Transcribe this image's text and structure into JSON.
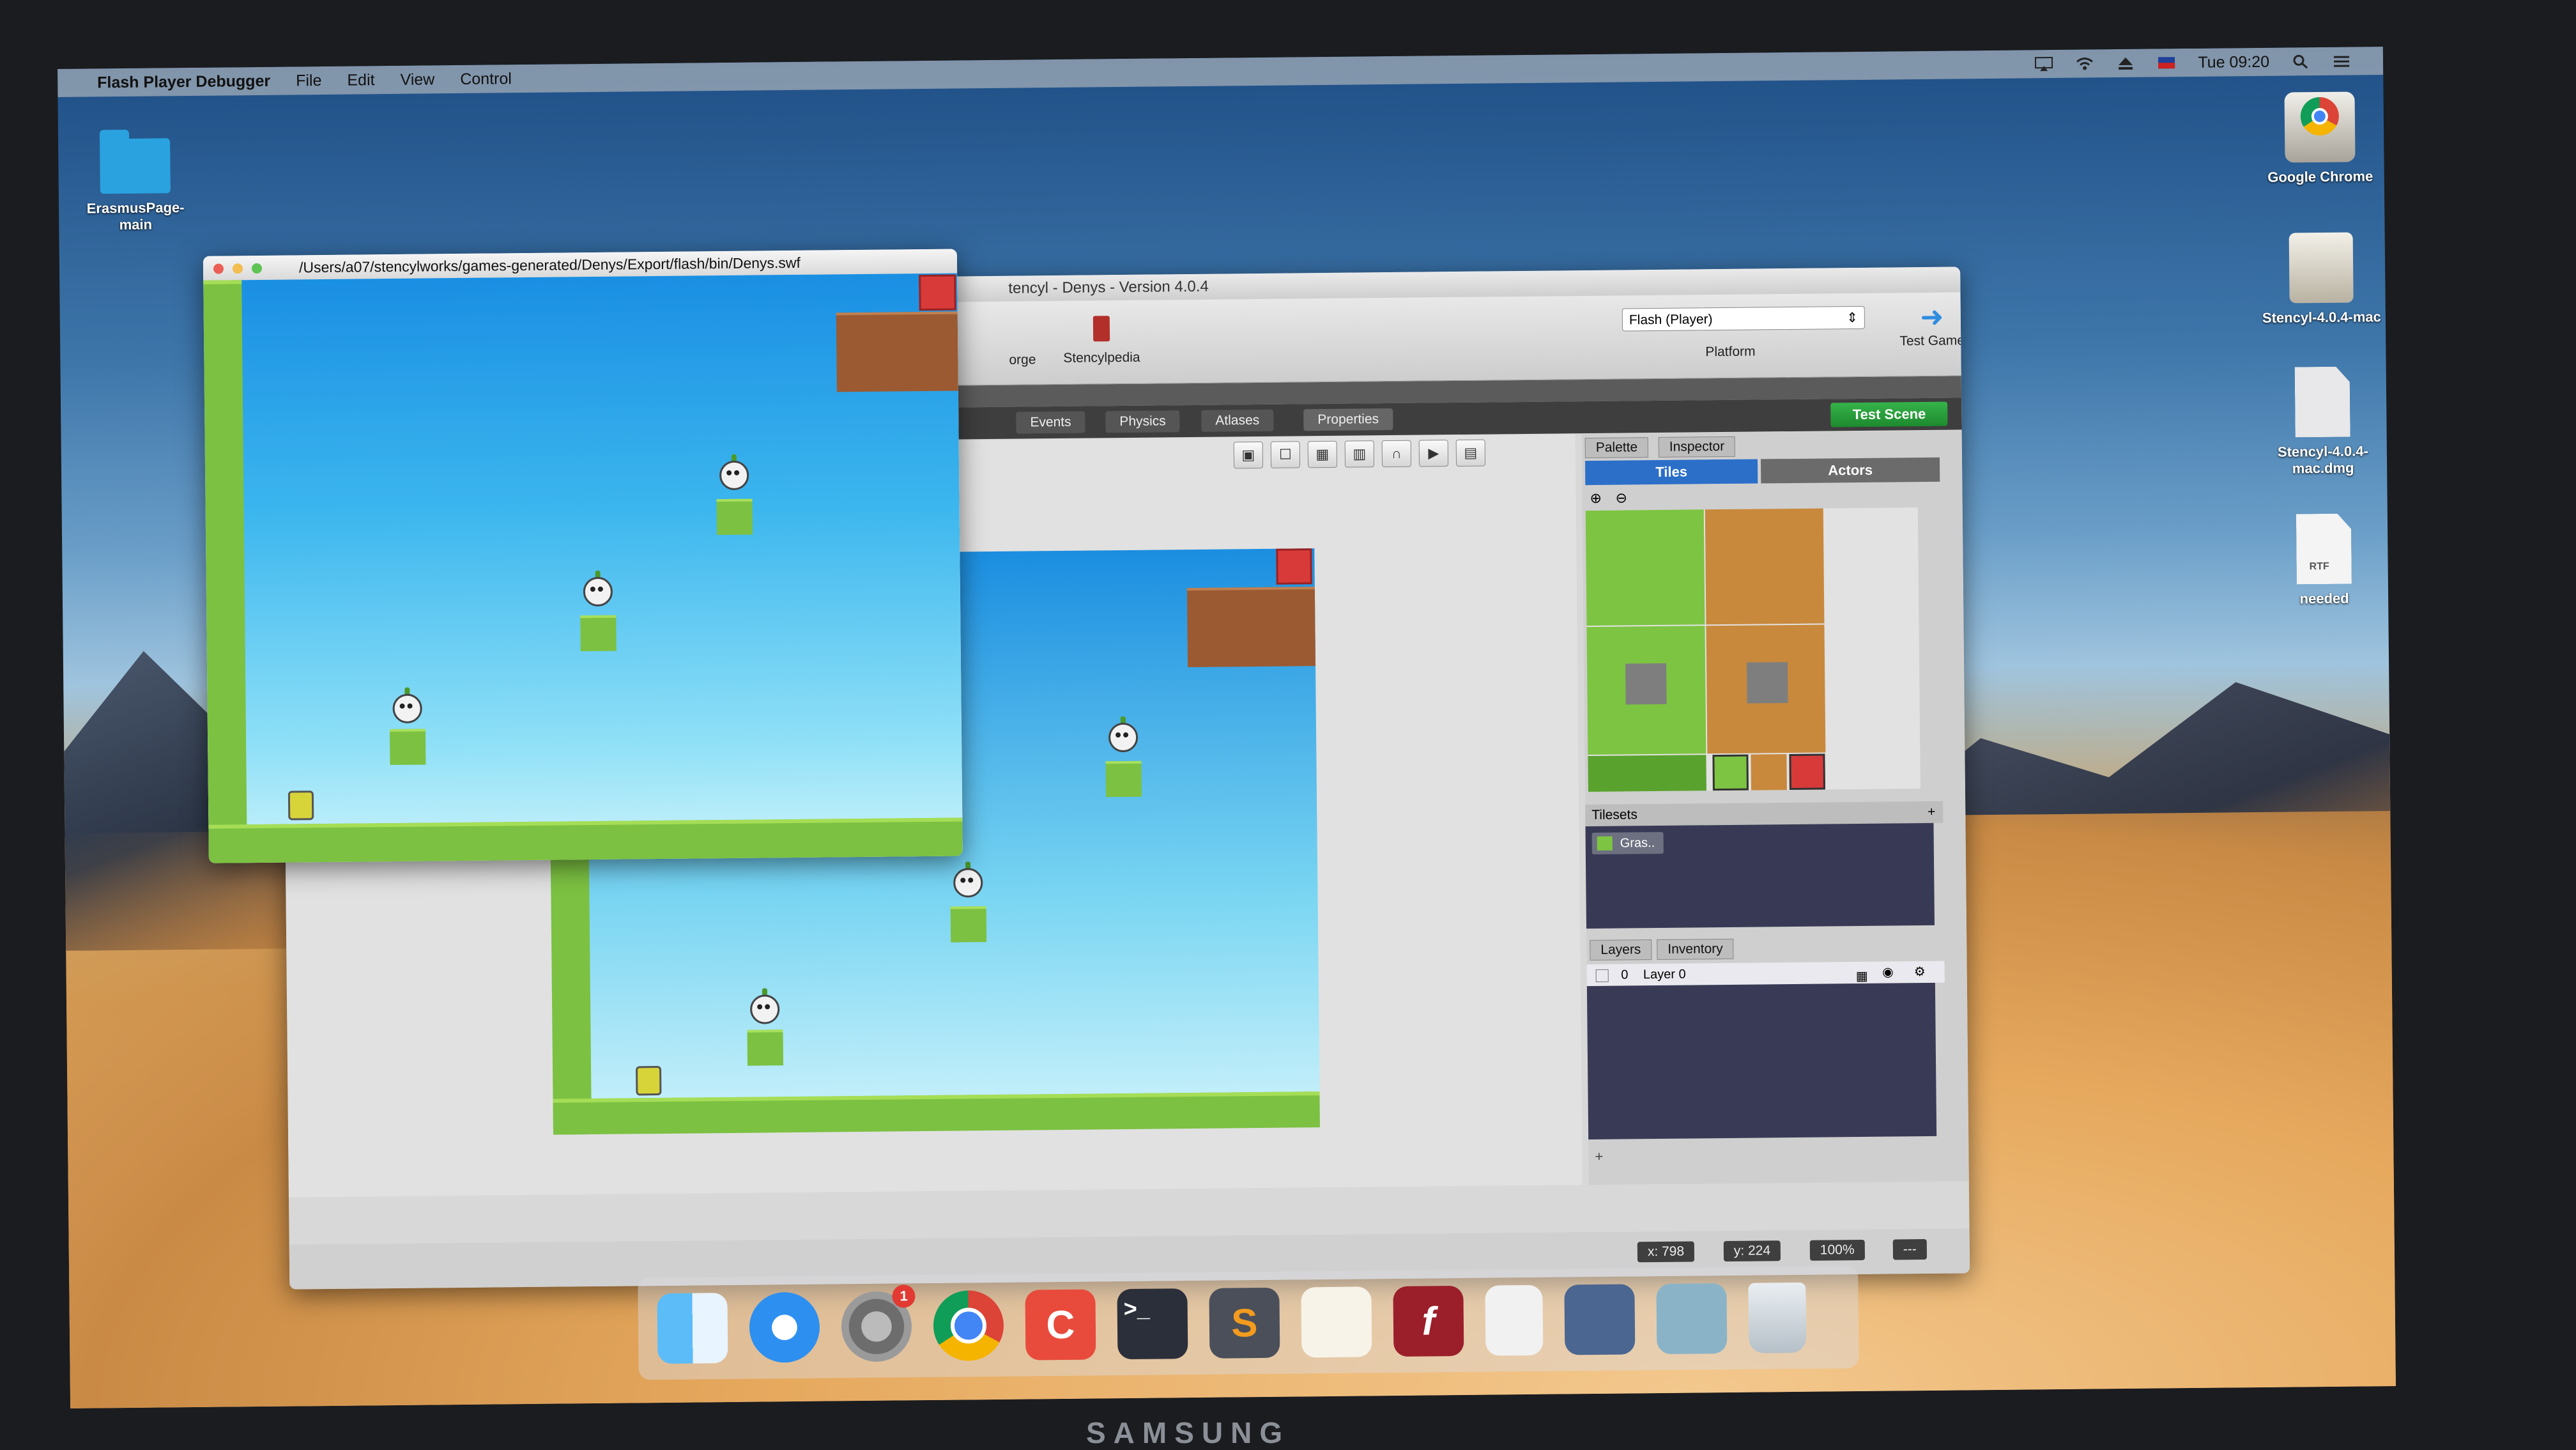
{
  "menubar": {
    "app_name": "Flash Player Debugger",
    "menus": [
      "File",
      "Edit",
      "View",
      "Control"
    ],
    "clock": "Tue 09:20"
  },
  "desktop": {
    "folder_label": "ErasmusPage-main",
    "icons": [
      {
        "label": "Google Chrome"
      },
      {
        "label": "Stencyl-4.0.4-mac"
      },
      {
        "label": "Stencyl-4.0.4-mac.dmg"
      },
      {
        "label": "needed"
      }
    ],
    "rtf_badge": "RTF"
  },
  "flash_window": {
    "title": "/Users/a07/stencylworks/games-generated/Denys/Export/flash/bin/Denys.swf"
  },
  "stencyl": {
    "title": "tencyl - Denys - Version 4.0.4",
    "toolbar": {
      "forge_label": "orge",
      "stencylpedia_label": "Stencylpedia",
      "platform_value": "Flash (Player)",
      "platform_label": "Platform",
      "test_game_label": "Test Game"
    },
    "tabs": [
      "Events",
      "Physics",
      "Atlases",
      "Properties"
    ],
    "test_scene_label": "Test Scene",
    "palette": {
      "tabs": [
        "Palette",
        "Inspector"
      ],
      "subtabs": [
        "Tiles",
        "Actors"
      ],
      "tilesets_header": "Tilesets",
      "tileset_item": "Gras..",
      "layers_tabs": [
        "Layers",
        "Inventory"
      ],
      "layer_index": "0",
      "layer_name": "Layer 0"
    },
    "status": {
      "x": "x: 798",
      "y": "y: 224",
      "zoom": "100%",
      "extra": "---"
    }
  },
  "dock": {
    "apps": [
      "Finder",
      "Safari",
      "System Preferences",
      "Google Chrome",
      "Stencyl",
      "Terminal",
      "Sublime Text",
      "TextEdit",
      "Flash Player",
      "Documents",
      "Downloads",
      "Screenshot",
      "Trash"
    ],
    "notification_count": "1"
  },
  "monitor_brand": "SAMSUNG"
}
